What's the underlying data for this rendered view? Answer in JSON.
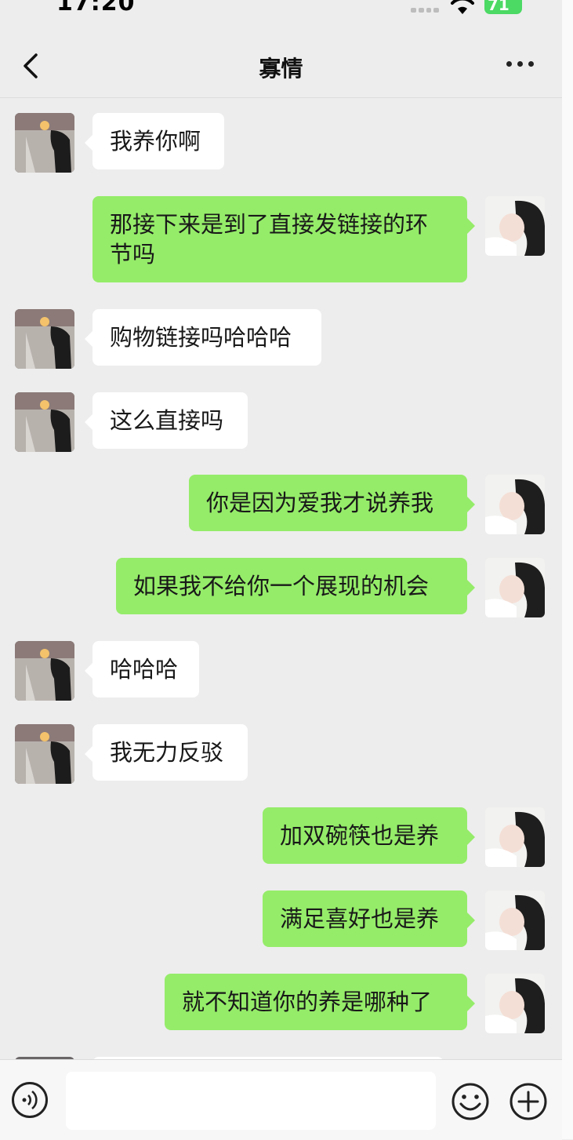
{
  "status_bar": {
    "time": "17:20",
    "battery": "71"
  },
  "header": {
    "title": "寡情",
    "back_icon": "chevron-left-icon",
    "more_icon": "more-dots-icon"
  },
  "messages": [
    {
      "side": "left",
      "text": "我养你啊"
    },
    {
      "side": "right",
      "text": "那接下来是到了直接发链接的环节吗"
    },
    {
      "side": "left",
      "text": "购物链接吗哈哈哈"
    },
    {
      "side": "left",
      "text": "这么直接吗"
    },
    {
      "side": "right",
      "text": "你是因为爱我才说养我"
    },
    {
      "side": "right",
      "text": "如果我不给你一个展现的机会"
    },
    {
      "side": "left",
      "text": "哈哈哈"
    },
    {
      "side": "left",
      "text": "我无力反驳"
    },
    {
      "side": "right",
      "text": "加双碗筷也是养"
    },
    {
      "side": "right",
      "text": "满足喜好也是养"
    },
    {
      "side": "right",
      "text": "就不知道你的养是哪种了"
    }
  ],
  "input_bar": {
    "voice_icon": "voice-icon",
    "emoji_icon": "emoji-icon",
    "add_icon": "plus-circle-icon",
    "value": ""
  },
  "colors": {
    "background": "#ededed",
    "outgoing_bubble": "#95ec69",
    "incoming_bubble": "#ffffff",
    "battery": "#4cd964"
  }
}
